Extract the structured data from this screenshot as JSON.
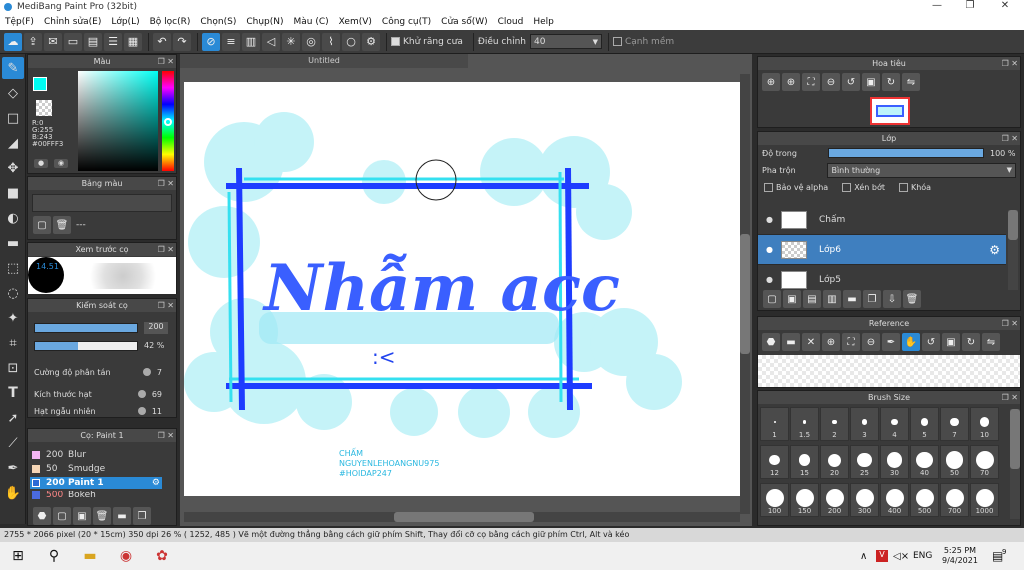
{
  "app": {
    "title": "MediBang Paint Pro (32bit)",
    "window_controls": [
      "—",
      "❐",
      "✕"
    ]
  },
  "menu": [
    "Tệp(F)",
    "Chỉnh sửa(E)",
    "Lớp(L)",
    "Bộ lọc(R)",
    "Chọn(S)",
    "Chụp(N)",
    "Màu (C)",
    "Xem(V)",
    "Công cụ(T)",
    "Cửa sổ(W)",
    "Cloud",
    "Help"
  ],
  "toolbar": {
    "antialias_label": "Khử răng cưa",
    "adjust_label": "Điều chỉnh",
    "adjust_value": "40",
    "snap_label": "Cạnh mềm"
  },
  "color_panel": {
    "title": "Màu",
    "r": "R:0",
    "g": "G:255",
    "b": "B:243",
    "hex": "#00FFF3",
    "fg": "#00fff3"
  },
  "palette_panel": {
    "title": "Bảng màu",
    "dash": "---"
  },
  "preview_panel": {
    "title": "Xem trước cọ",
    "size": "14.51"
  },
  "brush_control": {
    "title": "Kiểm soát cọ",
    "size_value": "200",
    "opacity_value": "42 %",
    "rows": [
      {
        "label": "Cường độ phân tán",
        "value": "7"
      },
      {
        "label": "Kích thước hạt",
        "value": "69"
      },
      {
        "label": "Hạt ngẫu nhiên",
        "value": "11"
      }
    ]
  },
  "brush_list": {
    "title": "Cọ: Paint 1",
    "items": [
      {
        "size": "200",
        "name": "Blur",
        "color": "#f5b6f5"
      },
      {
        "size": "50",
        "name": "Smudge",
        "color": "#f5d5b5"
      },
      {
        "size": "200",
        "name": "Paint 1",
        "color": "#2a8ad6"
      },
      {
        "size": "500",
        "name": "Bokeh",
        "color": "#4a6adf"
      }
    ]
  },
  "canvas": {
    "doc_title": "Untitled",
    "credit1": "CHẤM",
    "credit2": "NGUYENLEHOANGNU975",
    "credit3": "#HOIDAP247",
    "big_text": "Nhẫm acc",
    "face": ":<"
  },
  "navigator": {
    "title": "Hoa tiêu"
  },
  "layers": {
    "title": "Lớp",
    "opacity_label": "Độ trong",
    "opacity_value": "100 %",
    "opacity_fraction": 1.0,
    "blend_label": "Pha trộn",
    "blend_value": "Bình thường",
    "protect_alpha": "Bảo vệ alpha",
    "clip": "Xén bớt",
    "lock": "Khóa",
    "items": [
      "Chấm",
      "Lớp6",
      "Lớp5"
    ]
  },
  "reference": {
    "title": "Reference"
  },
  "brush_size": {
    "title": "Brush Size",
    "sizes": [
      "1",
      "1.5",
      "2",
      "3",
      "4",
      "5",
      "7",
      "10",
      "12",
      "15",
      "20",
      "25",
      "30",
      "40",
      "50",
      "70",
      "100",
      "150",
      "200",
      "300",
      "400",
      "500",
      "700",
      "1000"
    ]
  },
  "status": "2755 * 2066 pixel  (20 * 15cm)  350 dpi  26 %  ( 1252, 485 )  Vẽ một đường thẳng bằng cách giữ phím Shift, Thay đổi cỡ cọ bằng cách giữ phím Ctrl, Alt và kéo",
  "taskbar": {
    "lang": "ENG",
    "time": "5:25 PM",
    "date": "9/4/2021",
    "notif": "9"
  }
}
